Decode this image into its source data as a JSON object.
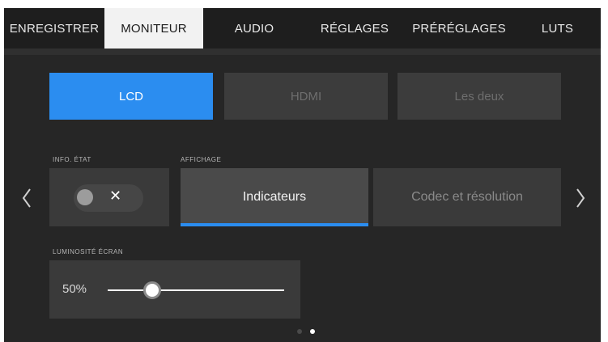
{
  "tabs": [
    {
      "label": "ENREGISTRER",
      "active": false
    },
    {
      "label": "MONITEUR",
      "active": true
    },
    {
      "label": "AUDIO",
      "active": false
    },
    {
      "label": "RÉGLAGES",
      "active": false
    },
    {
      "label": "PRÉRÉGLAGES",
      "active": false
    },
    {
      "label": "LUTS",
      "active": false
    }
  ],
  "output_selector": {
    "options": [
      "LCD",
      "HDMI",
      "Les deux"
    ],
    "selected": "LCD"
  },
  "status_info": {
    "label": "INFO. ÉTAT",
    "toggle_on": false,
    "toggle_symbol": "✕"
  },
  "display": {
    "label": "AFFICHAGE",
    "options": [
      "Indicateurs",
      "Codec et résolution"
    ],
    "selected": "Indicateurs"
  },
  "brightness": {
    "label": "LUMINOSITÉ ÉCRAN",
    "value_text": "50%",
    "value": 0.5
  },
  "pagination": {
    "pages": 2,
    "current": 2
  },
  "nav": {
    "prev_icon": "chevron-left-icon",
    "next_icon": "chevron-right-icon"
  },
  "colors": {
    "accent": "#2b8df0",
    "background": "#262626",
    "tabbar": "#1e1e1e"
  }
}
